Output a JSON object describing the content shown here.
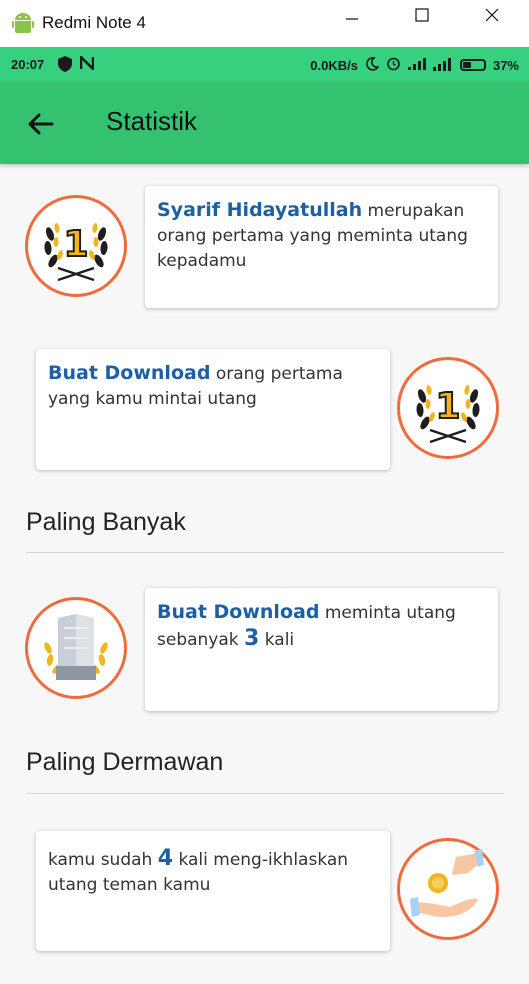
{
  "window": {
    "title": "Redmi Note 4"
  },
  "status_bar": {
    "time": "20:07",
    "speed": "0.0KB/s",
    "battery": "37%"
  },
  "app_bar": {
    "title": "Statistik"
  },
  "first_borrower": {
    "name": "Syarif Hidayatullah",
    "text": " merupakan orang pertama yang meminta utang kepadamu"
  },
  "first_lender": {
    "name": "Buat Download",
    "text": " orang pertama yang kamu mintai utang"
  },
  "most_section": {
    "title": "Paling Banyak",
    "name": "Buat Download",
    "text_before": " meminta utang sebanyak ",
    "count": "3",
    "text_after": " kali"
  },
  "generous_section": {
    "title": "Paling Dermawan",
    "text_before": "kamu sudah ",
    "count": "4",
    "text_after": " kali meng-ikhlaskan utang teman kamu"
  },
  "colors": {
    "status_bar": "#36d07f",
    "app_bar": "#34c271",
    "highlight": "#1c5fa5",
    "badge_border": "#f06b3a"
  }
}
